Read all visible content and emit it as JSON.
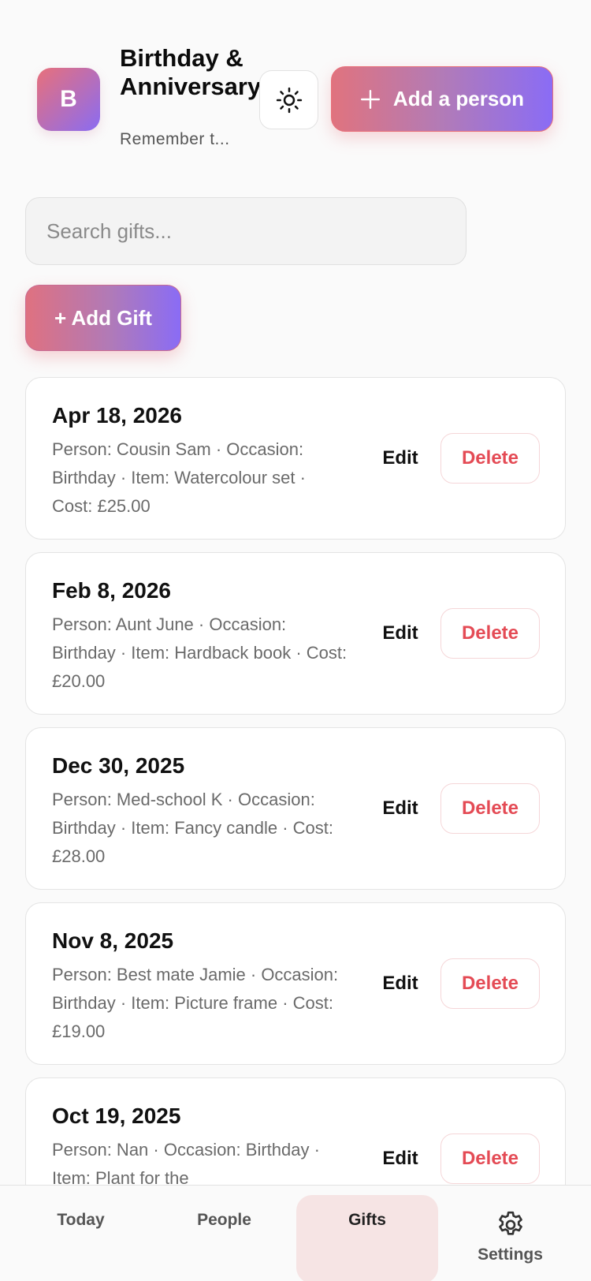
{
  "header": {
    "avatar_letter": "B",
    "title": "Birthday & Anniversary",
    "subtitle": "Remember t...",
    "add_person_label": "Add a person"
  },
  "search": {
    "placeholder": "Search gifts..."
  },
  "add_gift_label": "+ Add Gift",
  "gifts": [
    {
      "date": "Apr 18, 2026",
      "details": "Person: Cousin Sam · Occasion: Birthday · Item: Watercolour set · Cost: £25.00",
      "edit": "Edit",
      "delete": "Delete"
    },
    {
      "date": "Feb 8, 2026",
      "details": "Person: Aunt June · Occasion: Birthday · Item: Hardback book · Cost: £20.00",
      "edit": "Edit",
      "delete": "Delete"
    },
    {
      "date": "Dec 30, 2025",
      "details": "Person: Med-school K · Occasion: Birthday · Item: Fancy candle · Cost: £28.00",
      "edit": "Edit",
      "delete": "Delete"
    },
    {
      "date": "Nov 8, 2025",
      "details": "Person: Best mate Jamie · Occasion: Birthday · Item: Picture frame · Cost: £19.00",
      "edit": "Edit",
      "delete": "Delete"
    },
    {
      "date": "Oct 19, 2025",
      "details": "Person: Nan · Occasion: Birthday · Item: Plant for the",
      "edit": "Edit",
      "delete": "Delete"
    }
  ],
  "nav": {
    "today": "Today",
    "people": "People",
    "gifts": "Gifts",
    "settings": "Settings"
  },
  "colors": {
    "accent_start": "#e0737e",
    "accent_end": "#8a6cf5",
    "delete_red": "#e44b55",
    "active_tab_bg": "#f6e4e4"
  },
  "icons": {
    "theme": "sun-icon",
    "add": "plus-icon",
    "settings": "gear-icon"
  }
}
